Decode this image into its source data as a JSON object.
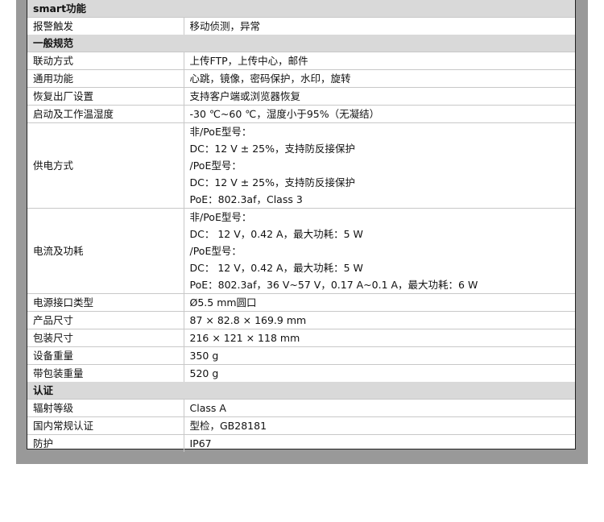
{
  "sections": [
    {
      "title": "smart功能",
      "rows": [
        {
          "key": "报警触发",
          "values": [
            "移动侦测，异常"
          ]
        }
      ]
    },
    {
      "title": "一般规范",
      "rows": [
        {
          "key": "联动方式",
          "values": [
            "上传FTP，上传中心，邮件"
          ]
        },
        {
          "key": "通用功能",
          "values": [
            "心跳，镜像，密码保护，水印，旋转"
          ]
        },
        {
          "key": "恢复出厂设置",
          "values": [
            "支持客户端或浏览器恢复"
          ]
        },
        {
          "key": "启动及工作温湿度",
          "values": [
            "-30 ℃~60 ℃，湿度小于95%（无凝结）"
          ]
        },
        {
          "key": "供电方式",
          "values": [
            "非/PoE型号：",
            "DC：12 V ± 25%，支持防反接保护",
            "/PoE型号：",
            "DC：12 V ± 25%，支持防反接保护",
            "PoE：802.3af，Class 3"
          ]
        },
        {
          "key": "电流及功耗",
          "values": [
            "非/PoE型号：",
            "DC：  12 V，0.42 A，最大功耗：5 W",
            "/PoE型号：",
            "DC：  12 V，0.42 A，最大功耗：5 W",
            "PoE：802.3af，36 V~57 V，0.17 A~0.1 A，最大功耗：6 W"
          ]
        },
        {
          "key": "电源接口类型",
          "values": [
            "Ø5.5 mm圆口"
          ]
        },
        {
          "key": "产品尺寸",
          "values": [
            "87 × 82.8 × 169.9 mm"
          ]
        },
        {
          "key": "包装尺寸",
          "values": [
            "216 × 121 × 118 mm"
          ]
        },
        {
          "key": "设备重量",
          "values": [
            "350 g"
          ]
        },
        {
          "key": "带包装重量",
          "values": [
            "520 g"
          ]
        }
      ]
    },
    {
      "title": "认证",
      "rows": [
        {
          "key": "辐射等级",
          "values": [
            "Class A"
          ]
        },
        {
          "key": "国内常规认证",
          "values": [
            "型检，GB28181"
          ]
        },
        {
          "key": "防护",
          "values": [
            "IP67"
          ]
        }
      ]
    }
  ]
}
